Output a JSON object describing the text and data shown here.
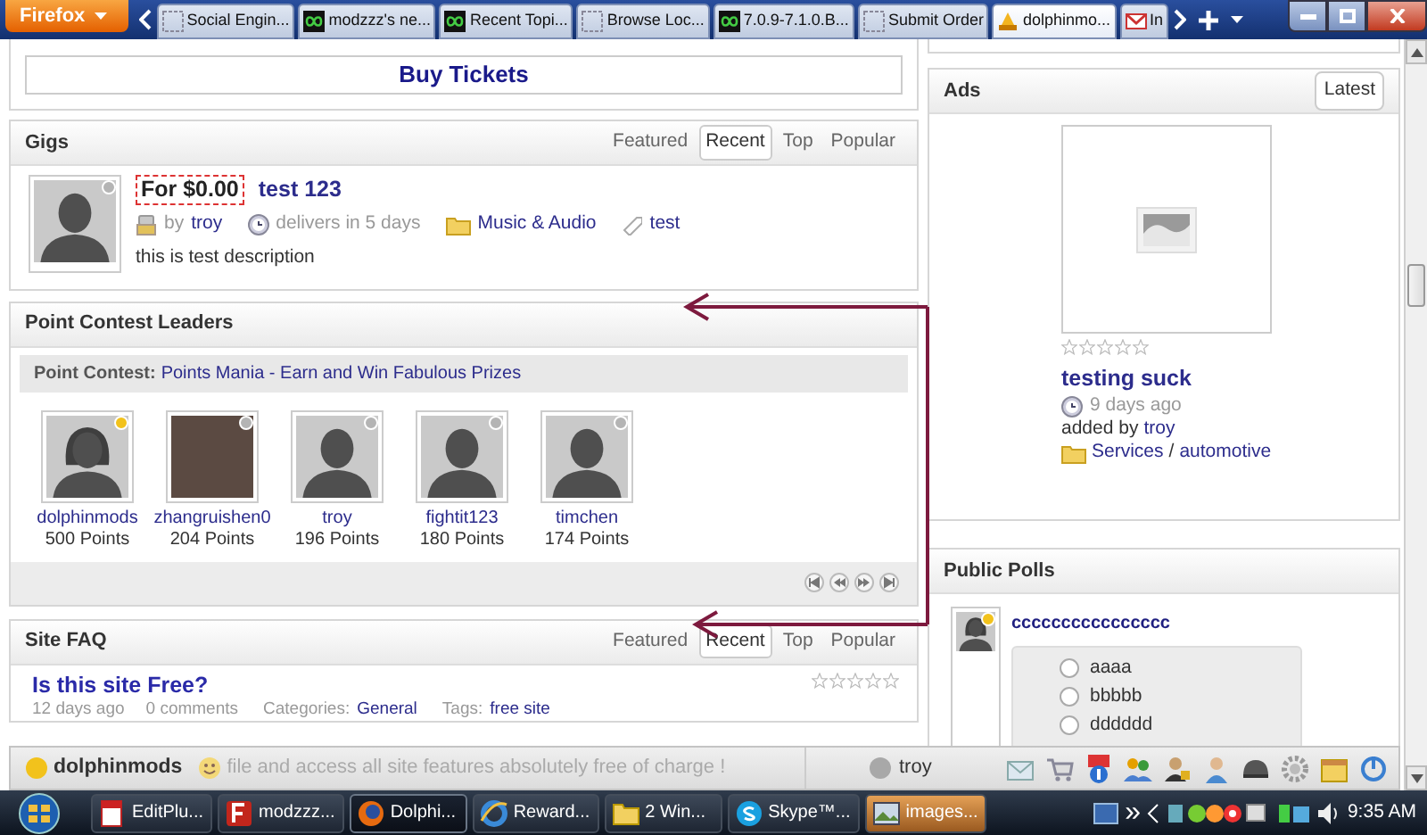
{
  "browser": {
    "menu_button": "Firefox",
    "tabs": [
      {
        "label": "Social Engin...",
        "kind": "blank",
        "selected": false
      },
      {
        "label": "modzzz's ne...",
        "kind": "infinity",
        "selected": false
      },
      {
        "label": "Recent Topi...",
        "kind": "infinity",
        "selected": false
      },
      {
        "label": "Browse Loc...",
        "kind": "blank",
        "selected": false
      },
      {
        "label": "7.0.9-7.1.0.B...",
        "kind": "infinity",
        "selected": false
      },
      {
        "label": "Submit Order",
        "kind": "blank",
        "selected": false
      },
      {
        "label": "dolphinmo...",
        "kind": "pma",
        "selected": true
      },
      {
        "label": "In",
        "kind": "gmail",
        "selected": false
      }
    ]
  },
  "buy_tickets": {
    "button": "Buy Tickets"
  },
  "gigs": {
    "title": "Gigs",
    "tabs": [
      {
        "label": "Featured",
        "selected": false
      },
      {
        "label": "Recent",
        "selected": true
      },
      {
        "label": "Top",
        "selected": false
      },
      {
        "label": "Popular",
        "selected": false
      }
    ],
    "items": [
      {
        "kind": "male",
        "color": "#b4b4b4",
        "price": "For $0.00",
        "title": "test 123",
        "by_label": "by",
        "author": "troy",
        "delivery": "delivers in 5 days",
        "category": "Music & Audio",
        "tag": "test",
        "description": "this is test description"
      }
    ]
  },
  "leaders": {
    "title": "Point Contest Leaders",
    "contest_label": "Point Contest:",
    "contest_name": "Points Mania - Earn and Win Fabulous Prizes",
    "members": [
      {
        "kind": "female",
        "color": "#f2c21c",
        "name": "dolphinmods",
        "points": "500 Points"
      },
      {
        "kind": "photo",
        "color": "#b4b4b4",
        "name": "zhangruishen0",
        "points": "204 Points"
      },
      {
        "kind": "male",
        "color": "#b4b4b4",
        "name": "troy",
        "points": "196 Points"
      },
      {
        "kind": "male",
        "color": "#b4b4b4",
        "name": "fightit123",
        "points": "180 Points"
      },
      {
        "kind": "male",
        "color": "#b4b4b4",
        "name": "timchen",
        "points": "174 Points"
      }
    ]
  },
  "faq": {
    "title": "Site FAQ",
    "tabs": [
      {
        "label": "Featured",
        "selected": false
      },
      {
        "label": "Recent",
        "selected": true
      },
      {
        "label": "Top",
        "selected": false
      },
      {
        "label": "Popular",
        "selected": false
      }
    ],
    "items": [
      {
        "question": "Is this site Free?",
        "stars": 0,
        "date": "12 days ago",
        "comments": "0 comments",
        "categories_label": "Categories:",
        "category": "General",
        "tags_label": "Tags:",
        "tag": "free site"
      }
    ]
  },
  "ads": {
    "title": "Ads",
    "button": "Latest",
    "items": [
      {
        "stars": 0,
        "title": "testing suck",
        "date": "9 days ago",
        "added_by_label": "added by",
        "author": "troy",
        "category": "Services",
        "separator": "/",
        "subcategory": "automotive"
      }
    ]
  },
  "polls": {
    "title": "Public Polls",
    "items": [
      {
        "kind": "female",
        "color": "#f2c21c",
        "question": "cccccccccccccccc",
        "options": [
          {
            "label": "aaaa",
            "checked": false
          },
          {
            "label": "bbbbb",
            "checked": false
          },
          {
            "label": "dddddd",
            "checked": false
          }
        ]
      }
    ]
  },
  "chat_bar": {
    "users": [
      {
        "name": "dolphinmods",
        "color": "#f2c21c"
      },
      {
        "name": "troy",
        "color": "#a8a8a8"
      }
    ],
    "message": "file and access all site features absolutely free of charge !"
  },
  "taskbar": {
    "tasks": [
      {
        "label": "EditPlu...",
        "kind": "editor",
        "selected": false
      },
      {
        "label": "modzzz...",
        "kind": "ftp",
        "selected": false
      },
      {
        "label": "Dolphi...",
        "kind": "firefox",
        "selected": true
      },
      {
        "label": "Reward...",
        "kind": "ie",
        "selected": false
      },
      {
        "label": "2 Win...",
        "kind": "folder",
        "selected": false
      },
      {
        "label": "Skype™...",
        "kind": "skype",
        "selected": false
      },
      {
        "label": "images...",
        "kind": "image",
        "selected": false,
        "flashing": true
      }
    ],
    "tray_expand": "»",
    "clock": "9:35 AM"
  }
}
